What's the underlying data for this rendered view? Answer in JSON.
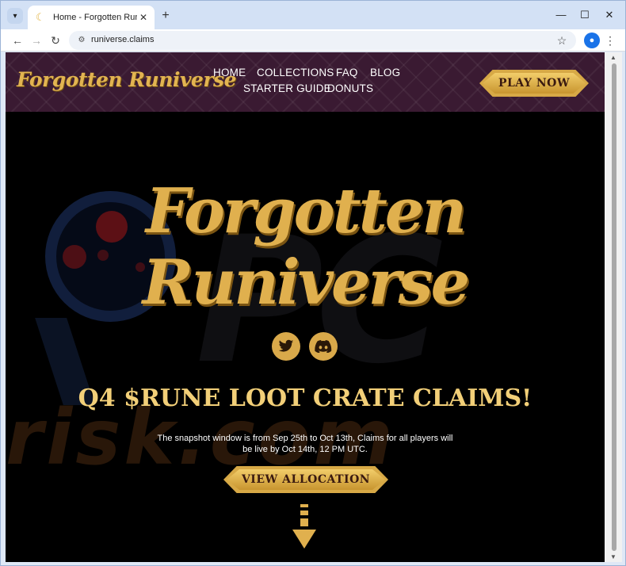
{
  "browser": {
    "tab_title": "Home - Forgotten Runiverse",
    "url": "runiverse.claims",
    "new_tab_label": "+",
    "close_tab_label": "✕",
    "minimize_label": "—",
    "maximize_label": "☐",
    "close_window_label": "✕"
  },
  "site": {
    "logo_text": "Forgotten Runiverse",
    "nav": {
      "home": "HOME",
      "collections": "COLLECTIONS",
      "faq": "FAQ",
      "blog": "BLOG",
      "starter_guide": "STARTER GUIDE",
      "donuts": "DONUTS"
    },
    "play_now": "PLAY NOW"
  },
  "hero": {
    "logo_line1": "Forgotten",
    "logo_line2": "Runiverse",
    "heading": "Q4 $RUNE LOOT CRATE CLAIMS!",
    "description": "The snapshot window is from Sep 25th to Oct 13th, Claims for all players will be live by Oct 14th, 12 PM UTC.",
    "cta": "VIEW ALLOCATION",
    "social": [
      "twitter-icon",
      "discord-icon"
    ]
  },
  "watermark": {
    "text": "risk.com",
    "letters": "PC"
  },
  "colors": {
    "gold": "#e0b04e",
    "header_bg": "#3a1a32",
    "page_bg": "#000000",
    "heading": "#f2cf78"
  }
}
